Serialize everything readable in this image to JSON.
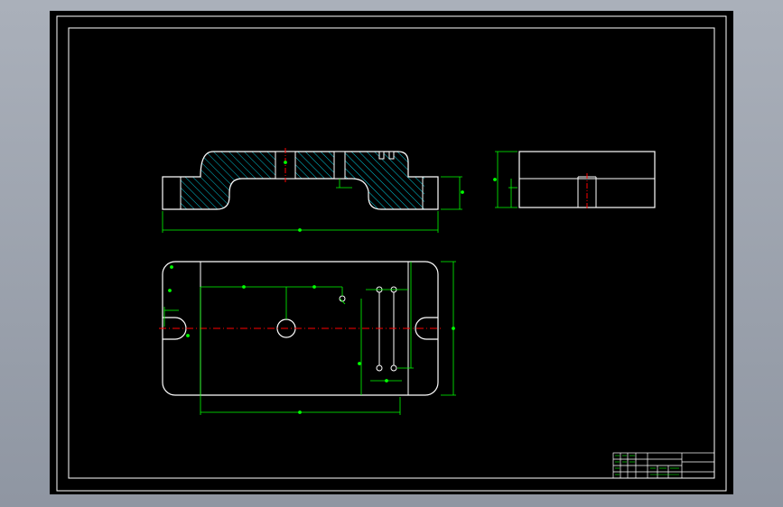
{
  "colors": {
    "background": "#000000",
    "outline": "#ffffff",
    "dimension": "#00ff00",
    "centerline": "#ff0000",
    "hatch": "#00c8d8",
    "page_backdrop": "#a0a7b2"
  },
  "views": [
    "front-section-view",
    "side-view",
    "top-view"
  ],
  "title_block": {
    "present": true,
    "text_legible": false
  }
}
